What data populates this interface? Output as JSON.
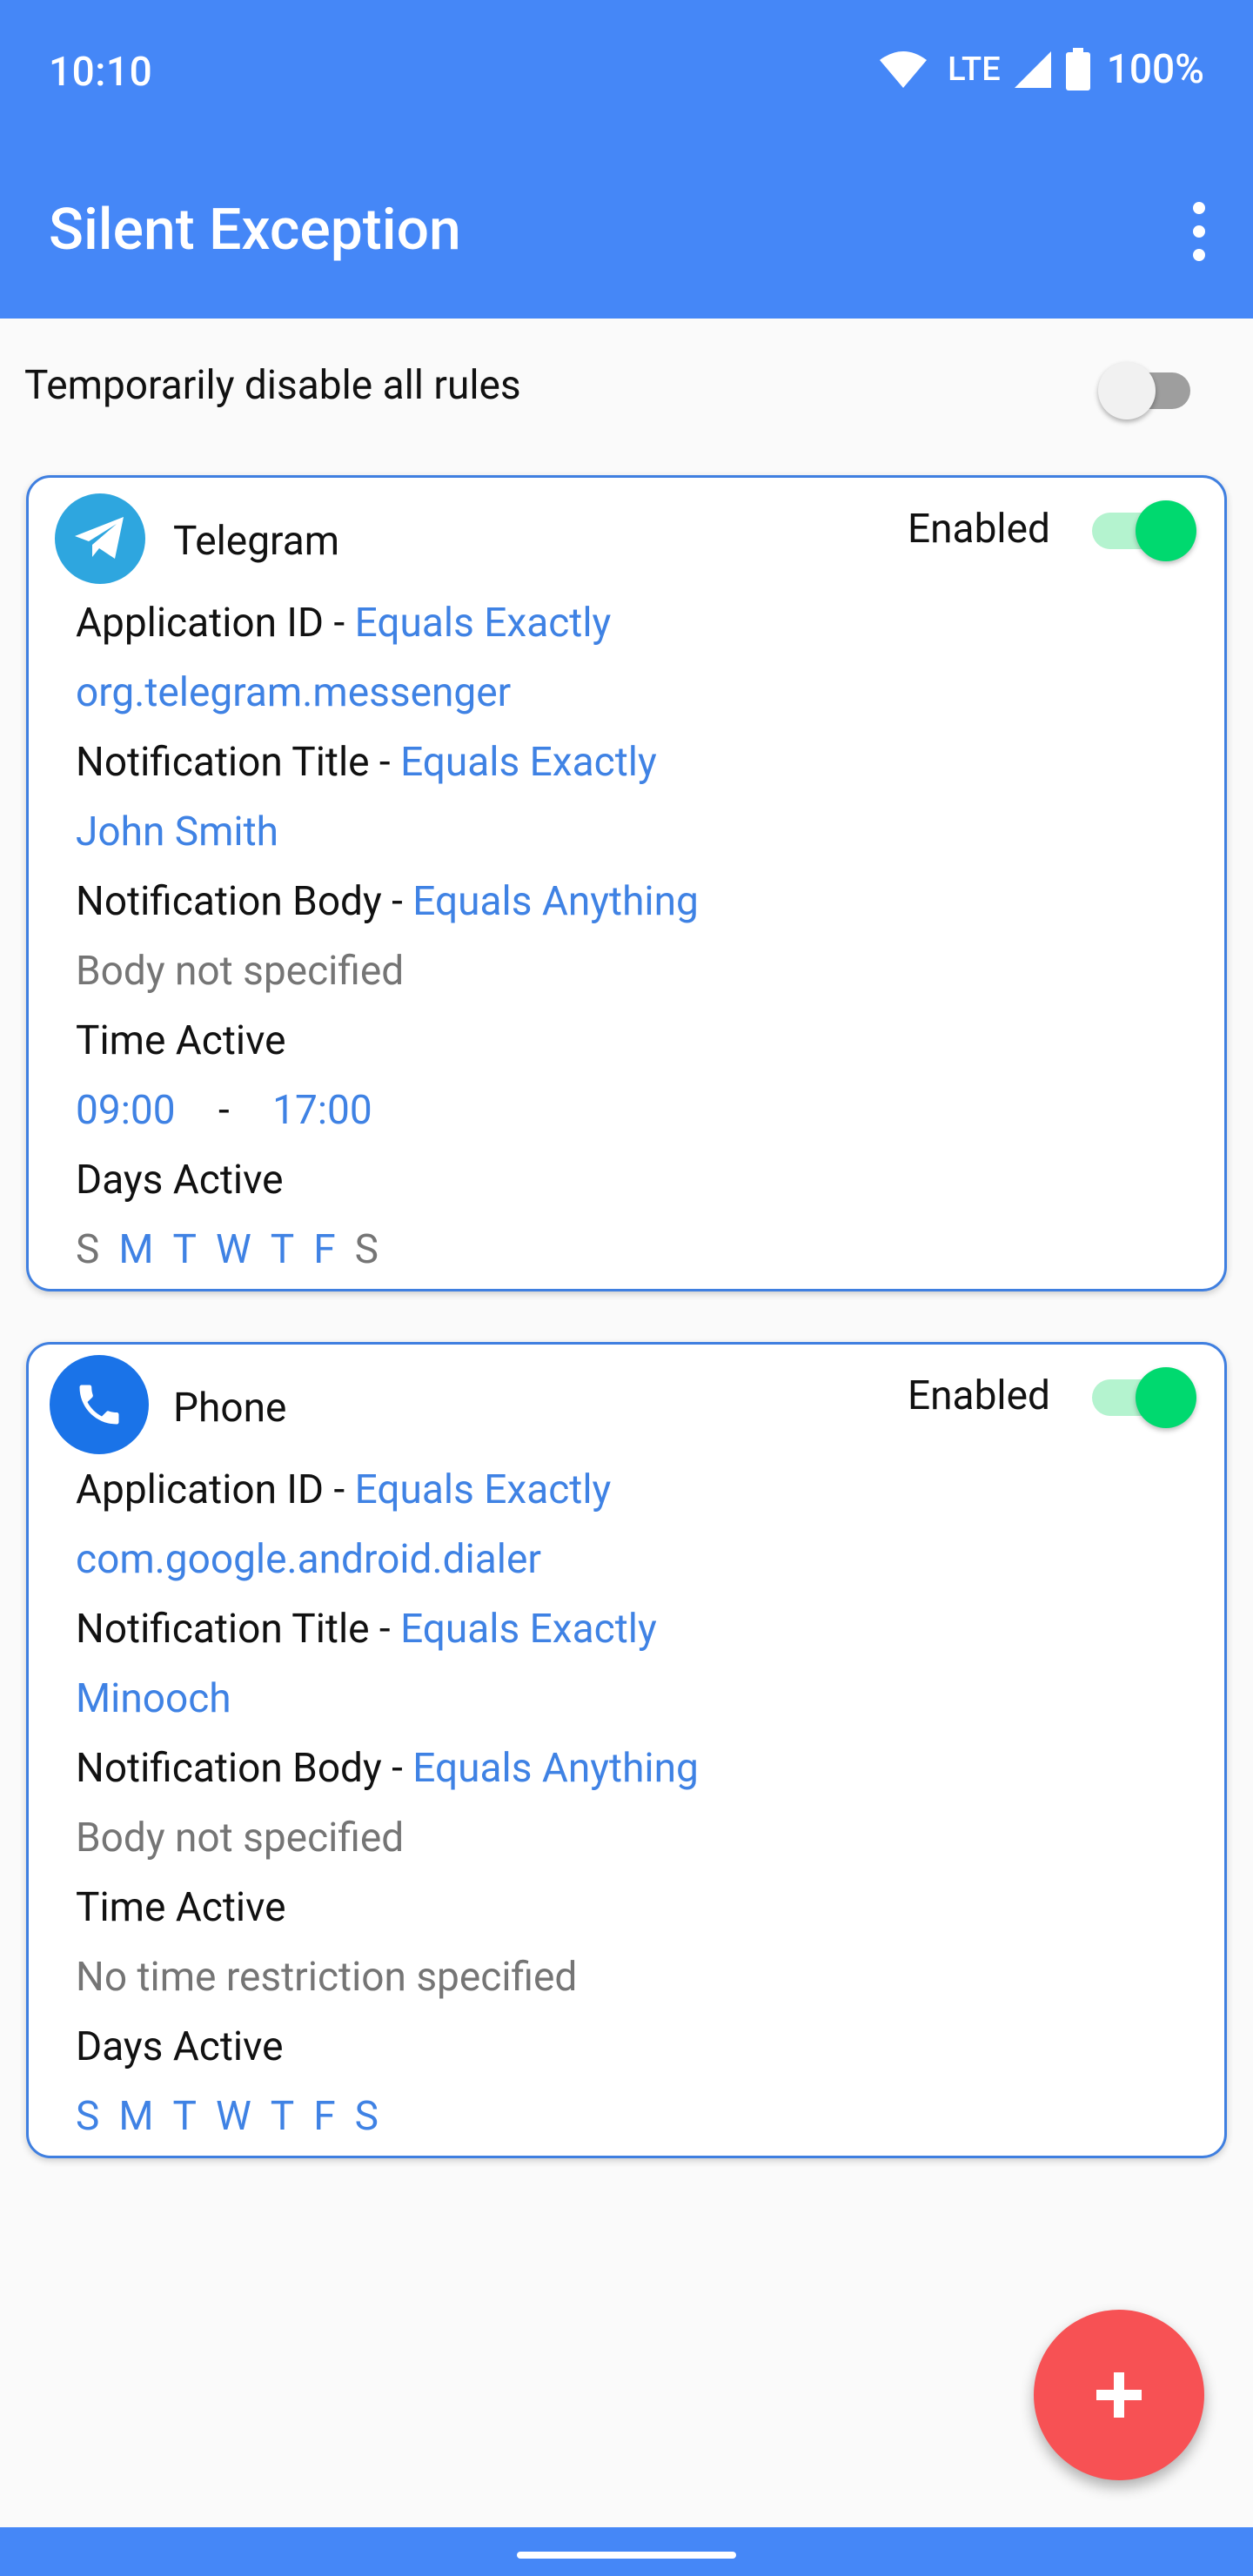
{
  "status_bar": {
    "time": "10:10",
    "network": "LTE",
    "battery": "100%"
  },
  "app_bar": {
    "title": "Silent Exception"
  },
  "master_toggle": {
    "label": "Temporarily disable all rules",
    "state": "off"
  },
  "rules": [
    {
      "app_name": "Telegram",
      "icon": "telegram-icon",
      "enabled_label": "Enabled",
      "enabled": true,
      "app_id_label": "Application ID - ",
      "app_id_mode": "Equals Exactly",
      "app_id_value": "org.telegram.messenger",
      "title_label": "Notification Title - ",
      "title_mode": "Equals Exactly",
      "title_value": "John Smith",
      "body_label": "Notification Body - ",
      "body_mode": "Equals Anything",
      "body_value": "Body not specified",
      "time_label": "Time Active",
      "time_start": "09:00",
      "time_sep": "-",
      "time_end": "17:00",
      "days_label": "Days Active",
      "days": [
        "S",
        "M",
        "T",
        "W",
        "T",
        "F",
        "S"
      ]
    },
    {
      "app_name": "Phone",
      "icon": "phone-icon",
      "enabled_label": "Enabled",
      "enabled": true,
      "app_id_label": "Application ID - ",
      "app_id_mode": "Equals Exactly",
      "app_id_value": "com.google.android.dialer",
      "title_label": "Notification Title - ",
      "title_mode": "Equals Exactly",
      "title_value": "Minooch",
      "body_label": "Notification Body - ",
      "body_mode": "Equals Anything",
      "body_value": "Body not specified",
      "time_label": "Time Active",
      "time_value": "No time restriction specified",
      "days_label": "Days Active",
      "days": [
        "S",
        "M",
        "T",
        "W",
        "T",
        "F",
        "S"
      ]
    }
  ],
  "fab": {
    "icon": "plus-icon"
  },
  "colors": {
    "primary": "#4587f7",
    "accent_text": "#3f82e4",
    "switch_on": "#00d96f",
    "fab": "#f75154"
  }
}
